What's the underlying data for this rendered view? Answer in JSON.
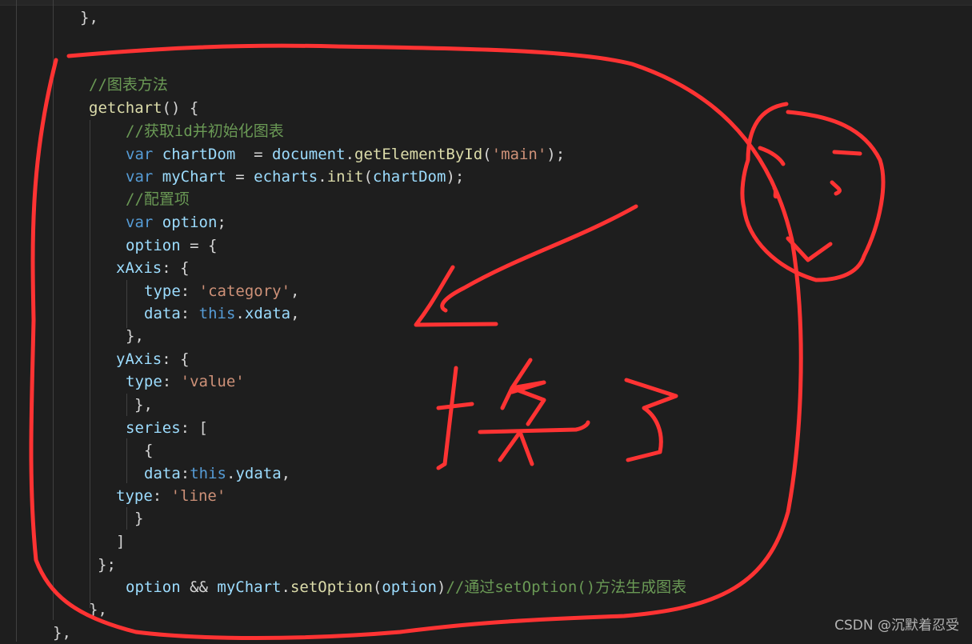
{
  "editor": {
    "theme_colors": {
      "background": "#1e1e1e",
      "keyword": "#569cd6",
      "variable": "#9cdcfe",
      "function": "#dcdcaa",
      "string": "#ce9178",
      "comment": "#6a9955"
    },
    "lines": [
      {
        "id": "l0",
        "tokens": [
          {
            "t": "},",
            "c": "pun"
          }
        ]
      },
      {
        "id": "l1",
        "tokens": [
          {
            "t": "//图表方法",
            "c": "cmt"
          }
        ]
      },
      {
        "id": "l2",
        "tokens": [
          {
            "t": "getchart",
            "c": "fn"
          },
          {
            "t": "() {",
            "c": "pun"
          }
        ]
      },
      {
        "id": "l3",
        "tokens": [
          {
            "t": "//获取id并初始化图表",
            "c": "cmt"
          }
        ]
      },
      {
        "id": "l4",
        "tokens": [
          {
            "t": "var",
            "c": "kw"
          },
          {
            "t": " chartDom",
            "c": "var"
          },
          {
            "t": "  = ",
            "c": "pun"
          },
          {
            "t": "document",
            "c": "var"
          },
          {
            "t": ".",
            "c": "pun"
          },
          {
            "t": "getElementById",
            "c": "fn"
          },
          {
            "t": "(",
            "c": "pun"
          },
          {
            "t": "'main'",
            "c": "str"
          },
          {
            "t": ");",
            "c": "pun"
          }
        ]
      },
      {
        "id": "l5",
        "tokens": [
          {
            "t": "var",
            "c": "kw"
          },
          {
            "t": " myChart",
            "c": "var"
          },
          {
            "t": " = ",
            "c": "pun"
          },
          {
            "t": "echarts",
            "c": "var"
          },
          {
            "t": ".",
            "c": "pun"
          },
          {
            "t": "init",
            "c": "fn"
          },
          {
            "t": "(",
            "c": "pun"
          },
          {
            "t": "chartDom",
            "c": "var"
          },
          {
            "t": ");",
            "c": "pun"
          }
        ]
      },
      {
        "id": "l6",
        "tokens": [
          {
            "t": "//配置项",
            "c": "cmt"
          }
        ]
      },
      {
        "id": "l7",
        "tokens": [
          {
            "t": "var",
            "c": "kw"
          },
          {
            "t": " option",
            "c": "var"
          },
          {
            "t": ";",
            "c": "pun"
          }
        ]
      },
      {
        "id": "l8",
        "tokens": [
          {
            "t": "option",
            "c": "var"
          },
          {
            "t": " = {",
            "c": "pun"
          }
        ]
      },
      {
        "id": "l9",
        "tokens": [
          {
            "t": "xAxis",
            "c": "var"
          },
          {
            "t": ": {",
            "c": "pun"
          }
        ]
      },
      {
        "id": "l10",
        "tokens": [
          {
            "t": "type",
            "c": "var"
          },
          {
            "t": ": ",
            "c": "pun"
          },
          {
            "t": "'category'",
            "c": "str"
          },
          {
            "t": ",",
            "c": "pun"
          }
        ]
      },
      {
        "id": "l11",
        "tokens": [
          {
            "t": "data",
            "c": "var"
          },
          {
            "t": ": ",
            "c": "pun"
          },
          {
            "t": "this",
            "c": "kw"
          },
          {
            "t": ".",
            "c": "pun"
          },
          {
            "t": "xdata",
            "c": "var"
          },
          {
            "t": ",",
            "c": "pun"
          }
        ]
      },
      {
        "id": "l12",
        "tokens": [
          {
            "t": "},",
            "c": "pun"
          }
        ]
      },
      {
        "id": "l13",
        "tokens": [
          {
            "t": "yAxis",
            "c": "var"
          },
          {
            "t": ": {",
            "c": "pun"
          }
        ]
      },
      {
        "id": "l14",
        "tokens": [
          {
            "t": "type",
            "c": "var"
          },
          {
            "t": ": ",
            "c": "pun"
          },
          {
            "t": "'value'",
            "c": "str"
          }
        ]
      },
      {
        "id": "l15",
        "tokens": [
          {
            "t": "},",
            "c": "pun"
          }
        ]
      },
      {
        "id": "l16",
        "tokens": [
          {
            "t": "series",
            "c": "var"
          },
          {
            "t": ": [",
            "c": "pun"
          }
        ]
      },
      {
        "id": "l17",
        "tokens": [
          {
            "t": "{",
            "c": "pun"
          }
        ]
      },
      {
        "id": "l18",
        "tokens": [
          {
            "t": "data",
            "c": "var"
          },
          {
            "t": ":",
            "c": "pun"
          },
          {
            "t": "this",
            "c": "kw"
          },
          {
            "t": ".",
            "c": "pun"
          },
          {
            "t": "ydata",
            "c": "var"
          },
          {
            "t": ",",
            "c": "pun"
          }
        ]
      },
      {
        "id": "l19",
        "tokens": [
          {
            "t": "type",
            "c": "var"
          },
          {
            "t": ": ",
            "c": "pun"
          },
          {
            "t": "'line'",
            "c": "str"
          }
        ]
      },
      {
        "id": "l20",
        "tokens": [
          {
            "t": "}",
            "c": "pun"
          }
        ]
      },
      {
        "id": "l21",
        "tokens": [
          {
            "t": "]",
            "c": "pun"
          }
        ]
      },
      {
        "id": "l22",
        "tokens": [
          {
            "t": "};",
            "c": "pun"
          }
        ]
      },
      {
        "id": "l23",
        "tokens": [
          {
            "t": "option",
            "c": "var"
          },
          {
            "t": " && ",
            "c": "pun"
          },
          {
            "t": "myChart",
            "c": "var"
          },
          {
            "t": ".",
            "c": "pun"
          },
          {
            "t": "setOption",
            "c": "fn"
          },
          {
            "t": "(",
            "c": "pun"
          },
          {
            "t": "option",
            "c": "var"
          },
          {
            "t": ")",
            "c": "pun"
          },
          {
            "t": "//通过setOption()方法生成图表",
            "c": "cmt"
          }
        ]
      },
      {
        "id": "l24",
        "tokens": [
          {
            "t": "},",
            "c": "pun"
          }
        ]
      },
      {
        "id": "l25",
        "tokens": [
          {
            "t": "},",
            "c": "pun"
          }
        ]
      }
    ]
  },
  "annotations": {
    "color": "#ff3333",
    "handwritten_text": "换了",
    "shapes": [
      "loop-around-code",
      "arrow-pointing-left",
      "face-doodle"
    ]
  },
  "watermark": "CSDN @沉默着忍受"
}
